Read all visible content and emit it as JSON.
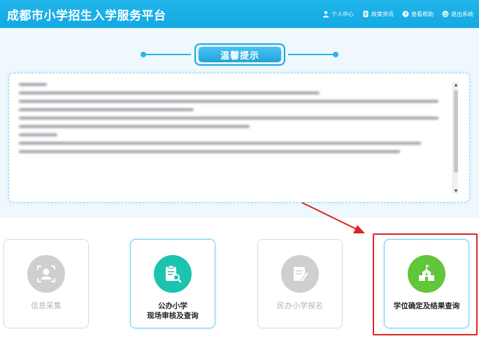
{
  "header": {
    "title": "成都市小学招生入学服务平台",
    "nav": [
      {
        "label": "个人中心",
        "icon": "user-icon"
      },
      {
        "label": "政策资讯",
        "icon": "document-icon"
      },
      {
        "label": "查看帮助",
        "icon": "help-icon"
      },
      {
        "label": "退出系统",
        "icon": "power-icon"
      }
    ]
  },
  "notice": {
    "title": "温馨提示"
  },
  "cards": [
    {
      "name": "info-collection",
      "label_lines": [
        "信息采集"
      ],
      "icon": "face-scan-icon",
      "state": "disabled"
    },
    {
      "name": "public-school-review",
      "label_lines": [
        "公办小学",
        "现场审核及查询"
      ],
      "icon": "clipboard-search-icon",
      "state": "active"
    },
    {
      "name": "private-school-signup",
      "label_lines": [
        "民办小学报名"
      ],
      "icon": "edit-form-icon",
      "state": "disabled"
    },
    {
      "name": "seat-confirm-result",
      "label_lines": [
        "学位确定及结果查询"
      ],
      "icon": "school-building-icon",
      "state": "active"
    }
  ],
  "colors": {
    "header_bg": "#14a9e3",
    "accent": "#1ea8df",
    "card_active_teal": "#1cc3ae",
    "card_active_green": "#62c63a",
    "card_disabled": "#cccccc",
    "highlight_red": "#e02424"
  }
}
